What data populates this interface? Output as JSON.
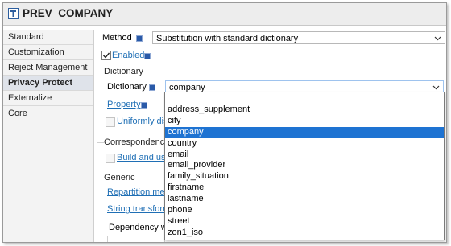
{
  "window": {
    "title": "PREV_COMPANY"
  },
  "sidebar": {
    "items": [
      {
        "label": "Standard"
      },
      {
        "label": "Customization"
      },
      {
        "label": "Reject Management"
      },
      {
        "label": "Privacy Protect"
      },
      {
        "label": "Externalize"
      },
      {
        "label": "Core"
      }
    ],
    "active_index": 3
  },
  "method": {
    "label": "Method",
    "value": "Substitution with standard dictionary"
  },
  "enabled": {
    "label": "Enabled",
    "checked": true
  },
  "dictionary_group": {
    "title": "Dictionary",
    "dictionary_label": "Dictionary",
    "dictionary_value": "company",
    "property_label": "Property",
    "uniformly_label": "Uniformly dis"
  },
  "correspondence_group": {
    "title": "Correspondence",
    "build_label": "Build and use"
  },
  "generic_group": {
    "title": "Generic",
    "repartition_label": "Repartition meth",
    "string_transform_label": "String transform",
    "dependency_label": "Dependency wit"
  },
  "dropdown": {
    "options": [
      "address_supplement",
      "city",
      "company",
      "country",
      "email",
      "email_provider",
      "family_situation",
      "firstname",
      "lastname",
      "phone",
      "street",
      "zon1_iso"
    ],
    "selected_index": 2
  },
  "colors": {
    "accent": "#1e73d2",
    "link": "#1f6fb5",
    "selection": "#1e73d2"
  }
}
